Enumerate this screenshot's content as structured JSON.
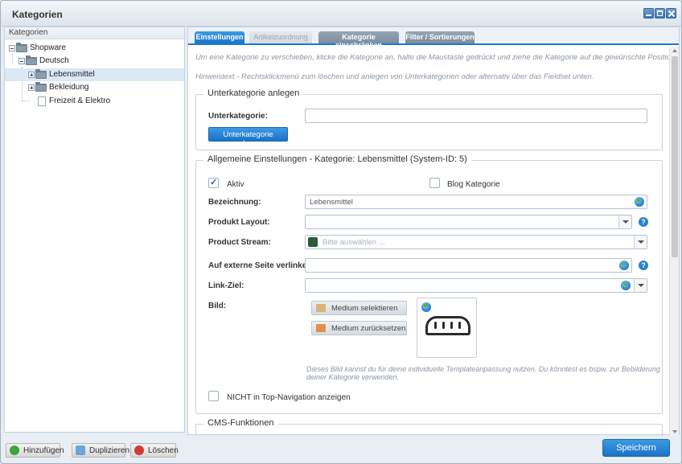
{
  "window": {
    "title": "Kategorien"
  },
  "tree": {
    "header": "Kategorien",
    "items": [
      {
        "label": "Shopware"
      },
      {
        "label": "Deutsch"
      },
      {
        "label": "Lebensmittel"
      },
      {
        "label": "Bekleidung"
      },
      {
        "label": "Freizeit & Elektro"
      }
    ]
  },
  "left_buttons": {
    "add": "Hinzufügen",
    "duplicate": "Duplizieren",
    "delete": "Löschen"
  },
  "tabs": [
    {
      "label": "Einstellungen"
    },
    {
      "label": "Artikelzuordnung"
    },
    {
      "label": "Kategorie einschränken"
    },
    {
      "label": "Filter / Sortierungen"
    }
  ],
  "hints": {
    "move": "Um eine Kategorie zu verschieben, klicke die Kategorie an, halte die Maustaste gedrückt und ziehe die Kategorie auf die gewünschte Position.",
    "context": "Hinweistext - Rechtsklickmenü zum löschen und anlegen von Unterkategorien oder alternativ über das Fieldset unten."
  },
  "sub": {
    "legend": "Unterkategorie anlegen",
    "label": "Unterkategorie:",
    "value": "",
    "button": "Unterkategorie anlegen"
  },
  "general": {
    "legend": "Allgemeine Einstellungen - Kategorie: Lebensmittel (System-ID: 5)",
    "active_label": "Aktiv",
    "active_checked": true,
    "blog_label": "Blog Kategorie",
    "blog_checked": false,
    "name_label": "Bezeichnung:",
    "name_value": "Lebensmittel",
    "layout_label": "Produkt Layout:",
    "layout_value": "",
    "stream_label": "Product Stream:",
    "stream_placeholder": "Bitte auswählen ...",
    "external_label": "Auf externe Seite verlinken:",
    "external_value": "",
    "target_label": "Link-Ziel:",
    "target_value": "",
    "image_label": "Bild:",
    "select_media": "Medium selektieren",
    "reset_media": "Medium zurücksetzen",
    "image_hint_1": "Dieses Bild kannst du für deine individuelle Templateanpassung nutzen. Du könntest es bspw. zur Bebilderung",
    "image_hint_2": "deiner Kategorie verwenden.",
    "nav_label": "NICHT in Top-Navigation anzeigen",
    "nav_checked": false
  },
  "cms": {
    "legend": "CMS-Funktionen"
  },
  "save": "Speichern",
  "colors": {
    "accent": "#1d7ad1",
    "selection": "#dbe9f6"
  },
  "icons": [
    "minimize-icon",
    "maximize-icon",
    "close-icon",
    "folder-icon",
    "page-icon",
    "globe-icon",
    "help-icon",
    "bread-icon",
    "product-stream-icon"
  ]
}
